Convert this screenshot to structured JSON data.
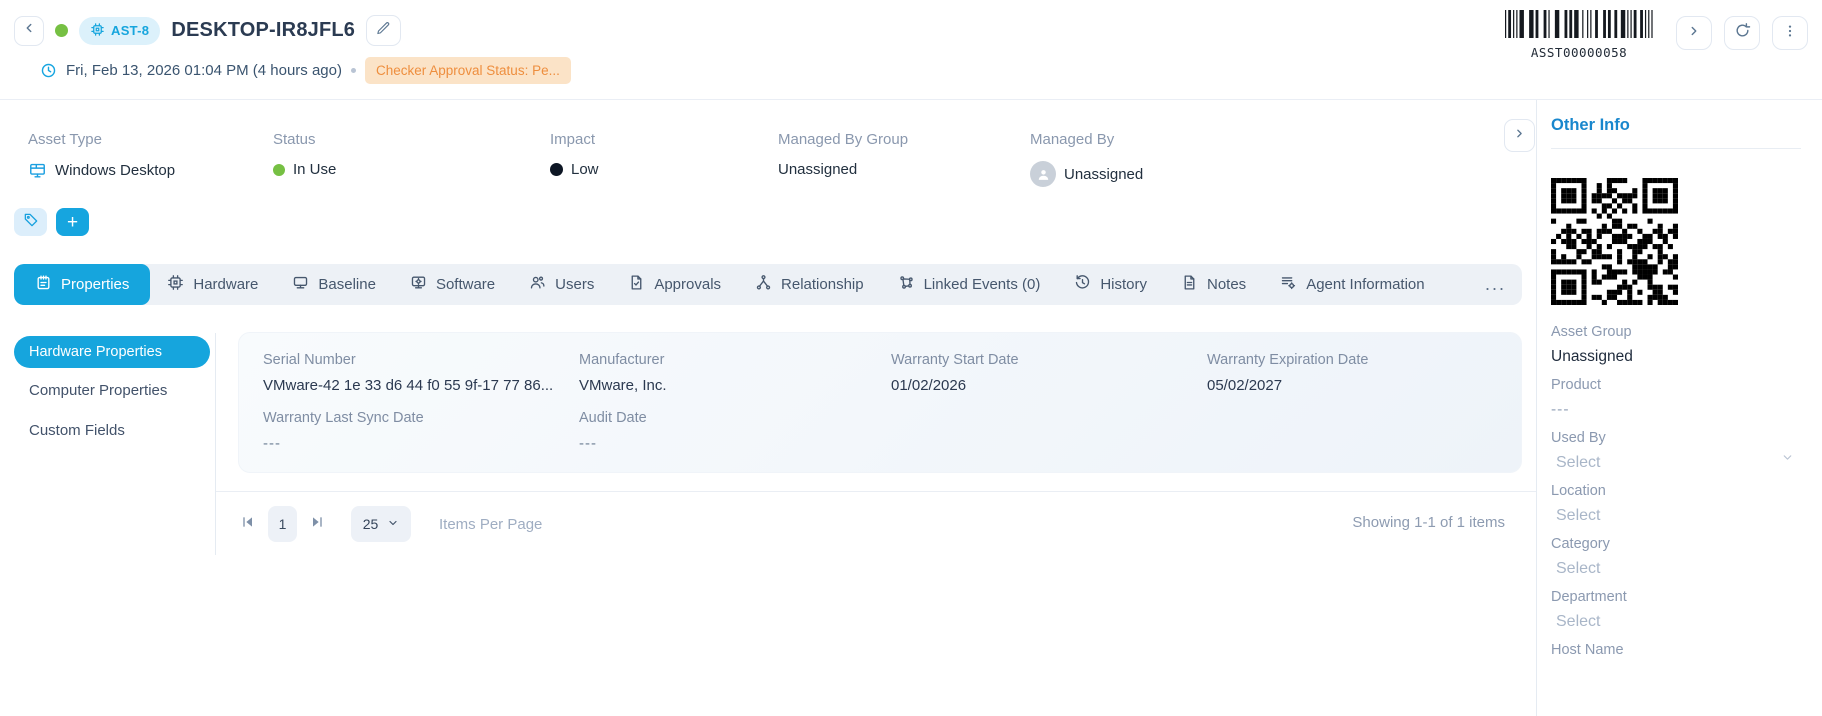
{
  "header": {
    "asset_badge": "AST-8",
    "title": "DESKTOP-IR8JFL6",
    "timestamp": "Fri, Feb 13, 2026 01:04 PM (4 hours ago)",
    "approval_status_badge": "Checker Approval Status: Pe...",
    "barcode_label": "ASST00000058"
  },
  "summary": {
    "asset_type": {
      "label": "Asset Type",
      "value": "Windows Desktop"
    },
    "status": {
      "label": "Status",
      "value": "In Use",
      "dot_color": "#76c043"
    },
    "impact": {
      "label": "Impact",
      "value": "Low",
      "dot_color": "#0d1624"
    },
    "managed_by_group": {
      "label": "Managed By Group",
      "value": "Unassigned"
    },
    "managed_by": {
      "label": "Managed By",
      "value": "Unassigned"
    }
  },
  "tabs": {
    "items": [
      {
        "label": "Properties"
      },
      {
        "label": "Hardware"
      },
      {
        "label": "Baseline"
      },
      {
        "label": "Software"
      },
      {
        "label": "Users"
      },
      {
        "label": "Approvals"
      },
      {
        "label": "Relationship"
      },
      {
        "label": "Linked Events (0)"
      },
      {
        "label": "History"
      },
      {
        "label": "Notes"
      },
      {
        "label": "Agent Information"
      }
    ],
    "more_label": "..."
  },
  "sidebar": {
    "items": [
      {
        "label": "Hardware Properties"
      },
      {
        "label": "Computer Properties"
      },
      {
        "label": "Custom Fields"
      }
    ]
  },
  "properties_card": {
    "fields": [
      {
        "label": "Serial Number",
        "value": "VMware-42 1e 33 d6 44 f0 55 9f-17 77 86..."
      },
      {
        "label": "Manufacturer",
        "value": "VMware, Inc."
      },
      {
        "label": "Warranty Start Date",
        "value": "01/02/2026"
      },
      {
        "label": "Warranty Expiration Date",
        "value": "05/02/2027"
      },
      {
        "label": "Warranty Last Sync Date",
        "value": "---"
      },
      {
        "label": "Audit Date",
        "value": "---"
      }
    ]
  },
  "pagination": {
    "current_page": "1",
    "page_size": "25",
    "items_per_page_label": "Items Per Page",
    "summary": "Showing 1-1 of 1 items"
  },
  "other_info": {
    "title": "Other Info",
    "fields": [
      {
        "label": "Asset Group",
        "value": "Unassigned",
        "kind": "text"
      },
      {
        "label": "Product",
        "value": "---",
        "kind": "muted"
      },
      {
        "label": "Used By",
        "value": "Select",
        "kind": "select"
      },
      {
        "label": "Location",
        "value": "Select",
        "kind": "select"
      },
      {
        "label": "Category",
        "value": "Select",
        "kind": "select"
      },
      {
        "label": "Department",
        "value": "Select",
        "kind": "select"
      },
      {
        "label": "Host Name",
        "value": "",
        "kind": "text"
      }
    ]
  },
  "colors": {
    "brand_blue": "#16a5dd",
    "badge_blue_bg": "#dcf1fb",
    "orange_badge_bg": "#fbe3c7",
    "orange_badge_text": "#ee8e3e",
    "status_green": "#76c043"
  }
}
